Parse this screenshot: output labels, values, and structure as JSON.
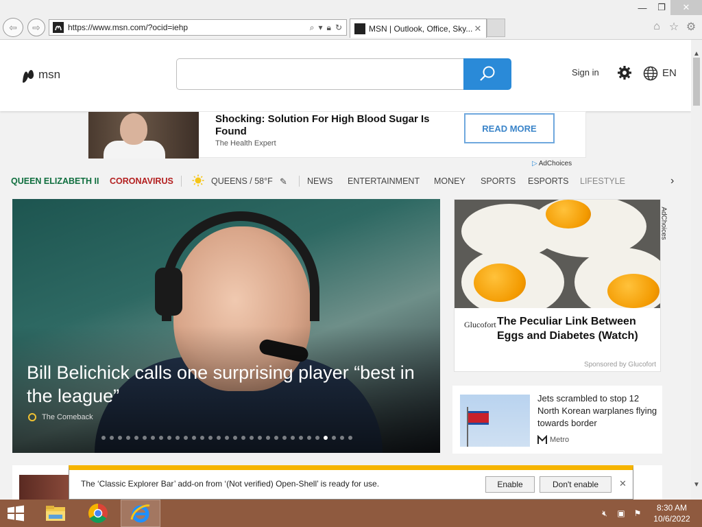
{
  "browser": {
    "url": "https://www.msn.com/?ocid=iehp",
    "tab_title": "MSN | Outlook, Office, Sky...",
    "window_controls": {
      "minimize": "—",
      "maximize": "❐",
      "close": "✕"
    }
  },
  "header": {
    "logo_text": "msn",
    "search_placeholder": "",
    "signin_label": "Sign in",
    "language": "EN"
  },
  "top_ad": {
    "title": "Shocking: Solution For High Blood Sugar Is Found",
    "source": "The Health Expert",
    "cta": "READ MORE",
    "adchoices": "AdChoices"
  },
  "nav": {
    "items": [
      "QUEEN ELIZABETH II",
      "CORONAVIRUS",
      "QUEENS / 58°F",
      "NEWS",
      "ENTERTAINMENT",
      "MONEY",
      "SPORTS",
      "ESPORTS",
      "LIFESTYLE"
    ]
  },
  "hero": {
    "headline": "Bill Belichick calls one surprising player “best in the league”",
    "source": "The Comeback",
    "slide_count": 31,
    "active_slide": 27
  },
  "right_ad": {
    "brand": "Glucofort",
    "title": "The Peculiar Link Between Eggs and Diabetes (Watch)",
    "sponsored": "Sponsored by Glucofort",
    "adchoices": "AdChoices"
  },
  "news_card": {
    "title": "Jets scrambled to stop 12 North Korean warplanes flying towards border",
    "source": "Metro"
  },
  "notification": {
    "message": "The ‘Classic Explorer Bar’ add-on from ‘(Not verified) Open-Shell’ is ready for use.",
    "enable_label": "Enable",
    "dont_enable_label": "Don't enable"
  },
  "taskbar": {
    "time": "8:30 AM",
    "date": "10/6/2022"
  },
  "colors": {
    "msn_blue": "#2a8ad8",
    "queen_green": "#0f6e3e",
    "corona_red": "#b32020",
    "notif_yellow": "#f6b400",
    "taskbar": "#8f5a3f"
  }
}
